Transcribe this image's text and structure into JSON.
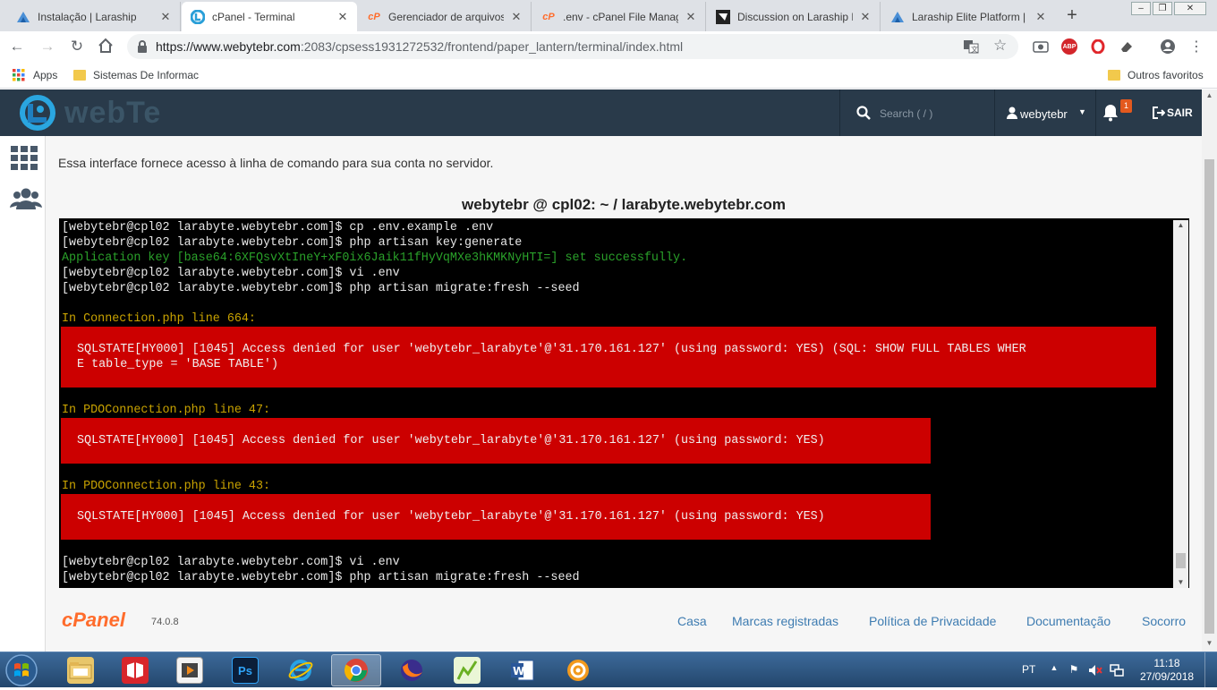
{
  "browser": {
    "tabs": [
      {
        "title": "Instalação | Laraship",
        "icon": "laraship-icon"
      },
      {
        "title": "cPanel - Terminal",
        "icon": "webytebr-icon"
      },
      {
        "title": "Gerenciador de arquivos",
        "icon": "cpanel-icon"
      },
      {
        "title": ".env - cPanel File Manager",
        "icon": "cpanel-icon"
      },
      {
        "title": "Discussion on Laraship E",
        "icon": "discussion-icon"
      },
      {
        "title": "Laraship Elite Platform |",
        "icon": "laraship-icon"
      }
    ],
    "url_host": "https://www.webytebr.com",
    "url_rest": ":2083/cpsess1931272532/frontend/paper_lantern/terminal/index.html",
    "bookmarks": {
      "apps": "Apps",
      "item1": "Sistemas De Informac",
      "other": "Outros favoritos"
    },
    "ext_abp": "ABP"
  },
  "cpanel": {
    "logo_text": "webTe",
    "search_placeholder": "Search ( / )",
    "username": "webytebr",
    "notifications": "1",
    "logout_label": "SAIR",
    "description": "Essa interface fornece acesso à linha de comando para sua conta no servidor.",
    "terminal_title": "webytebr @ cpl02: ~ / larabyte.webytebr.com",
    "terminal": {
      "l1": "[webytebr@cpl02 larabyte.webytebr.com]$ cp .env.example .env",
      "l2": "[webytebr@cpl02 larabyte.webytebr.com]$ php artisan key:generate",
      "l3": "Application key [base64:6XFQsvXtIneY+xF0ix6Jaik11fHyVqMXe3hKMKNyHTI=] set successfully.",
      "l4": "[webytebr@cpl02 larabyte.webytebr.com]$ vi .env",
      "l5": "[webytebr@cpl02 larabyte.webytebr.com]$ php artisan migrate:fresh --seed",
      "e1_head": "In Connection.php line 664:",
      "e1_l1": "SQLSTATE[HY000] [1045] Access denied for user 'webytebr_larabyte'@'31.170.161.127' (using password: YES) (SQL: SHOW FULL TABLES WHER",
      "e1_l2": "E table_type = 'BASE TABLE')",
      "e2_head": "In PDOConnection.php line 47:",
      "e2_l1": "SQLSTATE[HY000] [1045] Access denied for user 'webytebr_larabyte'@'31.170.161.127' (using password: YES)",
      "e3_head": "In PDOConnection.php line 43:",
      "e3_l1": "SQLSTATE[HY000] [1045] Access denied for user 'webytebr_larabyte'@'31.170.161.127' (using password: YES)",
      "l6": "[webytebr@cpl02 larabyte.webytebr.com]$ vi .env",
      "l7": "[webytebr@cpl02 larabyte.webytebr.com]$ php artisan migrate:fresh --seed"
    },
    "footer": {
      "brand": "cPanel",
      "version": "74.0.8",
      "links": [
        "Casa",
        "Marcas registradas",
        "Política de Privacidade",
        "Documentação",
        "Socorro"
      ]
    }
  },
  "taskbar": {
    "lang": "PT",
    "time": "11:18",
    "date": "27/09/2018",
    "ps_label": "Ps"
  },
  "colors": {
    "cp_header": "#293a4a",
    "error_bg": "#cc0000",
    "terminal_bg": "#000000",
    "link": "#3e7cb1",
    "cpanel_orange": "#ff6c2c"
  }
}
